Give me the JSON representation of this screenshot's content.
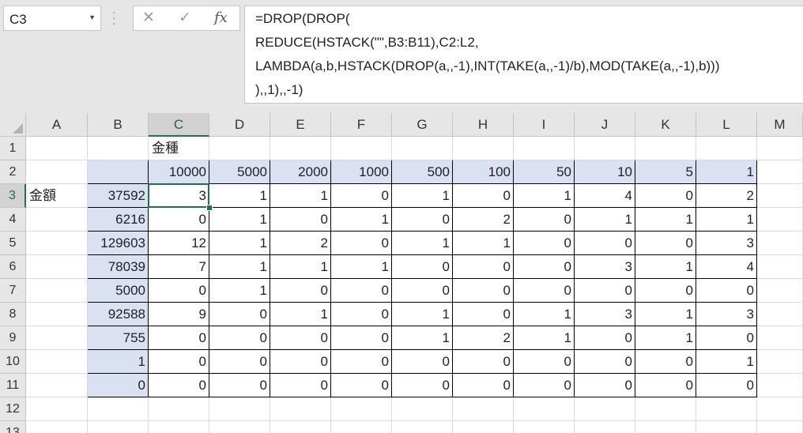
{
  "name_box": {
    "value": "C3"
  },
  "formula_bar": {
    "cancel_icon": "close-icon",
    "enter_icon": "checkmark-icon",
    "function_label": "fx",
    "lines": [
      "=DROP(DROP(",
      "REDUCE(HSTACK(\"\",B3:B11),C2:L2,",
      "LAMBDA(a,b,HSTACK(DROP(a,,-1),INT(TAKE(a,,-1)/b),MOD(TAKE(a,,-1),b)))",
      "),,1),,-1)"
    ]
  },
  "columns": [
    "A",
    "B",
    "C",
    "D",
    "E",
    "F",
    "G",
    "H",
    "I",
    "J",
    "K",
    "L",
    "M"
  ],
  "rows": [
    "1",
    "2",
    "3",
    "4",
    "5",
    "6",
    "7",
    "8",
    "9",
    "10",
    "11",
    "12",
    "13"
  ],
  "selected_cell": "C3",
  "cells": {
    "C1": "金種",
    "A3": "金額",
    "denominations": [
      "10000",
      "5000",
      "2000",
      "1000",
      "500",
      "100",
      "50",
      "10",
      "5",
      "1"
    ],
    "amounts": [
      "37592",
      "6216",
      "129603",
      "78039",
      "5000",
      "92588",
      "755",
      "1",
      "0"
    ],
    "counts": [
      [
        "3",
        "1",
        "1",
        "0",
        "1",
        "0",
        "1",
        "4",
        "0",
        "2"
      ],
      [
        "0",
        "1",
        "0",
        "1",
        "0",
        "2",
        "0",
        "1",
        "1",
        "1"
      ],
      [
        "12",
        "1",
        "2",
        "0",
        "1",
        "1",
        "0",
        "0",
        "0",
        "3"
      ],
      [
        "7",
        "1",
        "1",
        "1",
        "0",
        "0",
        "0",
        "3",
        "1",
        "4"
      ],
      [
        "0",
        "1",
        "0",
        "0",
        "0",
        "0",
        "0",
        "0",
        "0",
        "0"
      ],
      [
        "9",
        "0",
        "1",
        "0",
        "1",
        "0",
        "1",
        "3",
        "1",
        "3"
      ],
      [
        "0",
        "0",
        "0",
        "0",
        "1",
        "2",
        "1",
        "0",
        "1",
        "0"
      ],
      [
        "0",
        "0",
        "0",
        "0",
        "0",
        "0",
        "0",
        "0",
        "0",
        "1"
      ],
      [
        "0",
        "0",
        "0",
        "0",
        "0",
        "0",
        "0",
        "0",
        "0",
        "0"
      ]
    ]
  },
  "colors": {
    "accent": "#217346",
    "header_fill": "#d9e1f2"
  }
}
